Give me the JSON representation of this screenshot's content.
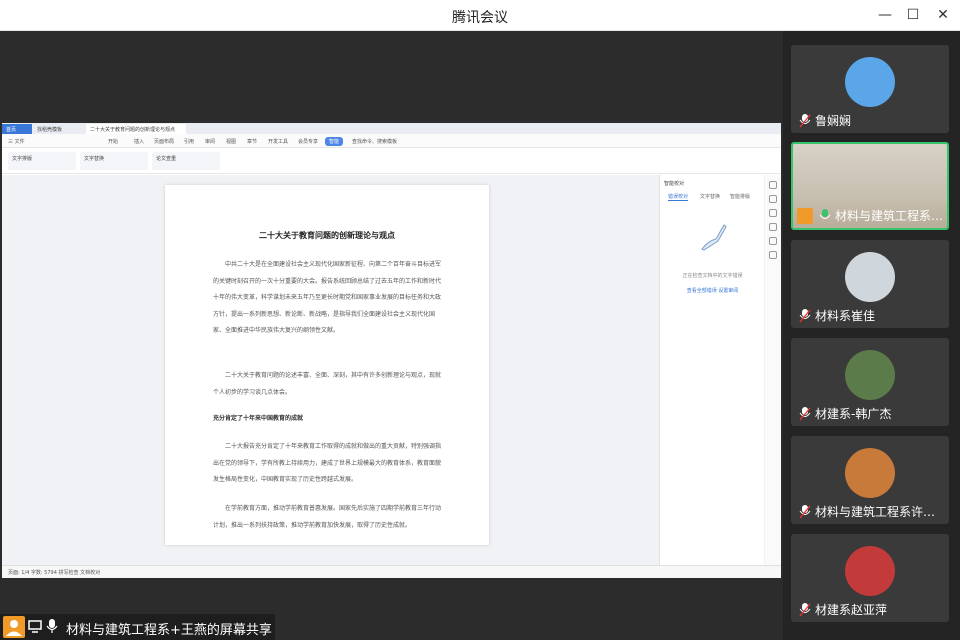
{
  "window": {
    "title": "腾讯会议"
  },
  "share": {
    "presenter_label": "材料与建筑工程系+王燕的屏幕共享",
    "wps": {
      "tabs": [
        "首页",
        "找稻壳模板",
        "二十大关于教育问题的创新理论与观点"
      ],
      "menu": [
        "三 文件",
        "开始",
        "插入",
        "页面布局",
        "引用",
        "审阅",
        "视图",
        "章节",
        "开发工具",
        "会员专享",
        "智能",
        "查找命令、搜索模板"
      ],
      "ribbon": [
        "文字排版",
        "文字替换",
        "论文查重"
      ],
      "document": {
        "title": "二十大关于教育问题的创新理论与观点",
        "paragraphs": [
          "中共二十大是在全面建设社会主义现代化国家新征程、向第二个百年奋斗目标进军的关键时刻召开的一次十分重要的大会。报告系统回顾总结了过去五年的工作和新时代十年的伟大变革，科学谋划未来五年乃至更长时期党和国家事业发展的目标任务和大政方针，提出一系列新思想、新论断、新战略，是指导我们全面建设社会主义现代化国家、全面推进中华民族伟大复兴的纲领性文献。",
          "二十大关于教育问题的论述丰富、全面、深刻，其中有许多创新理论与观点，现就个人初步的学习谈几点体会。",
          "充分肯定了十年来中国教育的成就",
          "二十大报告充分肯定了十年来教育工作取得的成就和做出的重大贡献，特别强调指出在党的领导下，学有所教上持续用力，建成了世界上规模最大的教育体系，教育面貌发生格局性变化，中国教育实现了历史性跨越式发展。",
          "在学前教育方面，推动学前教育普惠发展。国家先后实施了四期学前教育三年行动计划，推出一系列扶持政策，推动学前教育加快发展，取得了历史性成就。"
        ]
      },
      "sidepane": {
        "title": "智能校对",
        "tabs": [
          "错误校对",
          "文字替换",
          "智能排版"
        ],
        "hint": "正在检查文档中的文字错误",
        "link": "查看全部错误  设置审阅"
      },
      "status": "页面: 1/4   字数: 5794   拼写检查   文档校对"
    }
  },
  "participants": [
    {
      "name": "鲁娴娴",
      "avatar_color": "#5aa6e8",
      "host": false
    },
    {
      "name": "材料与建筑工程系+王燕",
      "avatar_color": "#f09a2a",
      "host": true
    },
    {
      "name": "材料系崔佳",
      "avatar_color": "#cfd6dc",
      "host": false
    },
    {
      "name": "材建系-韩广杰",
      "avatar_color": "#5b7c4a",
      "host": false
    },
    {
      "name": "材料与建筑工程系许晓坤",
      "avatar_color": "#c87a3a",
      "host": false
    },
    {
      "name": "材建系赵亚萍",
      "avatar_color": "#c23a3a",
      "host": false
    }
  ],
  "icons": {
    "minimize": "minimize-icon",
    "maximize": "maximize-icon",
    "close": "close-icon",
    "mic": "mic-icon",
    "screen": "screen-share-icon"
  },
  "colors": {
    "active_speaker": "#35c46a",
    "wps_accent": "#3a78d8"
  }
}
